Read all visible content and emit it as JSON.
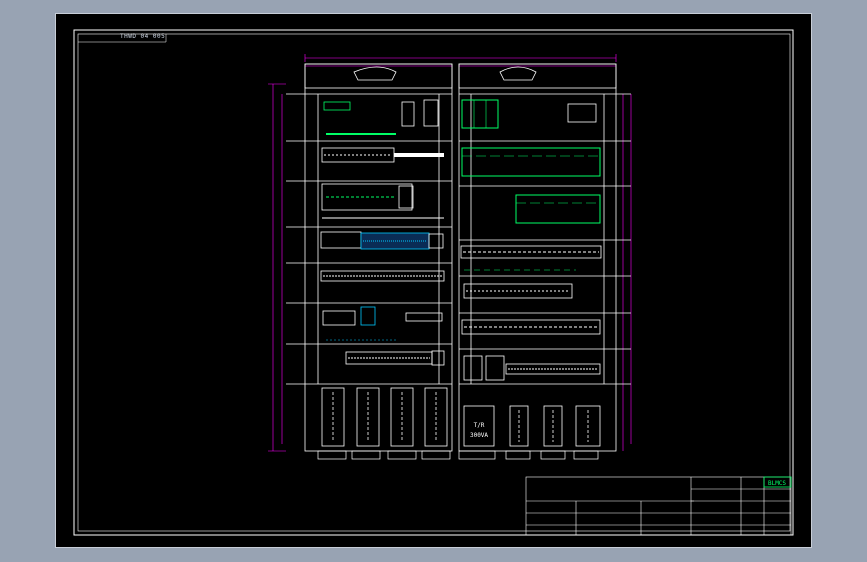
{
  "viewport": {
    "background": "#000000",
    "frame_color": "#c8ced8"
  },
  "sheet_label": "THWD  04 005",
  "transformer": {
    "line1": "T/R",
    "line2": "300VA"
  },
  "title_block": {
    "logo_text": "BLMCS"
  },
  "colors": {
    "panel_lines": "#ffffff",
    "dimensions": "#ff00ff",
    "components": "#00ff66",
    "labels": "#00c8ff",
    "frame": "#ffffff"
  },
  "icons": {
    "drawing": "cad-panel-layout",
    "title_block": "cad-title-block"
  }
}
